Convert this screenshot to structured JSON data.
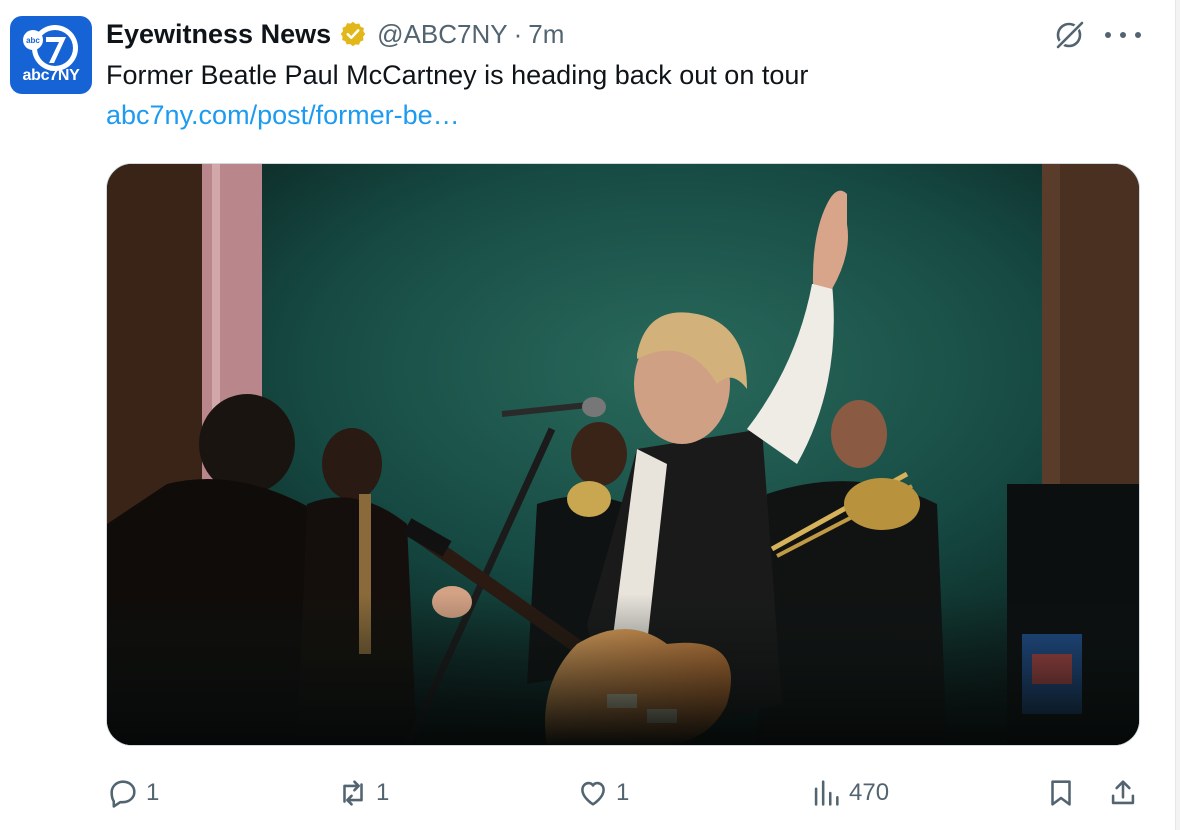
{
  "author": {
    "name": "Eyewitness News",
    "handle": "@ABC7NY",
    "separator": "·",
    "time": "7m",
    "avatar_text": "abc7NY",
    "avatar_badge_text": "abc",
    "avatar_badge_number": "7",
    "verified": true,
    "verified_color": "#e2b719"
  },
  "tweet": {
    "text": "Former Beatle Paul McCartney is heading back out on tour",
    "link": "abc7ny.com/post/former-be…"
  },
  "media": {
    "type": "photo",
    "description_icon": "concert-photo"
  },
  "actions": {
    "replies": "1",
    "reposts": "1",
    "likes": "1",
    "views": "470"
  },
  "colors": {
    "accent": "#1d9bf0",
    "muted": "#536471",
    "avatar_bg": "#1663d6"
  },
  "icons": [
    "grok-icon",
    "more-icon",
    "reply-icon",
    "repost-icon",
    "like-icon",
    "views-icon",
    "bookmark-icon",
    "share-icon"
  ]
}
